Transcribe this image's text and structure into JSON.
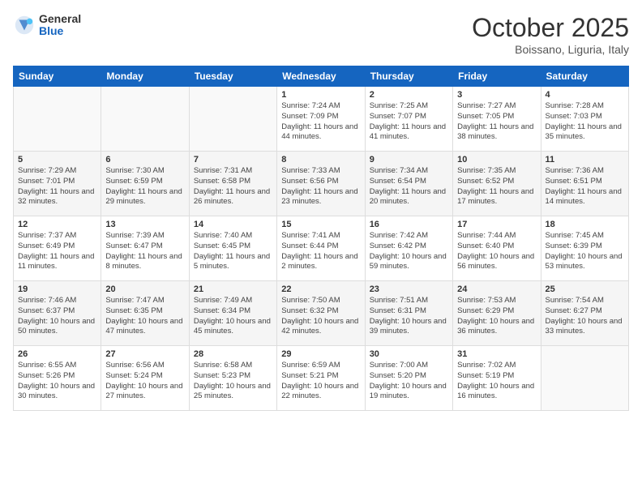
{
  "header": {
    "logo_general": "General",
    "logo_blue": "Blue",
    "month_title": "October 2025",
    "location": "Boissano, Liguria, Italy"
  },
  "weekdays": [
    "Sunday",
    "Monday",
    "Tuesday",
    "Wednesday",
    "Thursday",
    "Friday",
    "Saturday"
  ],
  "weeks": [
    [
      {
        "day": "",
        "info": ""
      },
      {
        "day": "",
        "info": ""
      },
      {
        "day": "",
        "info": ""
      },
      {
        "day": "1",
        "info": "Sunrise: 7:24 AM\nSunset: 7:09 PM\nDaylight: 11 hours\nand 44 minutes."
      },
      {
        "day": "2",
        "info": "Sunrise: 7:25 AM\nSunset: 7:07 PM\nDaylight: 11 hours\nand 41 minutes."
      },
      {
        "day": "3",
        "info": "Sunrise: 7:27 AM\nSunset: 7:05 PM\nDaylight: 11 hours\nand 38 minutes."
      },
      {
        "day": "4",
        "info": "Sunrise: 7:28 AM\nSunset: 7:03 PM\nDaylight: 11 hours\nand 35 minutes."
      }
    ],
    [
      {
        "day": "5",
        "info": "Sunrise: 7:29 AM\nSunset: 7:01 PM\nDaylight: 11 hours\nand 32 minutes."
      },
      {
        "day": "6",
        "info": "Sunrise: 7:30 AM\nSunset: 6:59 PM\nDaylight: 11 hours\nand 29 minutes."
      },
      {
        "day": "7",
        "info": "Sunrise: 7:31 AM\nSunset: 6:58 PM\nDaylight: 11 hours\nand 26 minutes."
      },
      {
        "day": "8",
        "info": "Sunrise: 7:33 AM\nSunset: 6:56 PM\nDaylight: 11 hours\nand 23 minutes."
      },
      {
        "day": "9",
        "info": "Sunrise: 7:34 AM\nSunset: 6:54 PM\nDaylight: 11 hours\nand 20 minutes."
      },
      {
        "day": "10",
        "info": "Sunrise: 7:35 AM\nSunset: 6:52 PM\nDaylight: 11 hours\nand 17 minutes."
      },
      {
        "day": "11",
        "info": "Sunrise: 7:36 AM\nSunset: 6:51 PM\nDaylight: 11 hours\nand 14 minutes."
      }
    ],
    [
      {
        "day": "12",
        "info": "Sunrise: 7:37 AM\nSunset: 6:49 PM\nDaylight: 11 hours\nand 11 minutes."
      },
      {
        "day": "13",
        "info": "Sunrise: 7:39 AM\nSunset: 6:47 PM\nDaylight: 11 hours\nand 8 minutes."
      },
      {
        "day": "14",
        "info": "Sunrise: 7:40 AM\nSunset: 6:45 PM\nDaylight: 11 hours\nand 5 minutes."
      },
      {
        "day": "15",
        "info": "Sunrise: 7:41 AM\nSunset: 6:44 PM\nDaylight: 11 hours\nand 2 minutes."
      },
      {
        "day": "16",
        "info": "Sunrise: 7:42 AM\nSunset: 6:42 PM\nDaylight: 10 hours\nand 59 minutes."
      },
      {
        "day": "17",
        "info": "Sunrise: 7:44 AM\nSunset: 6:40 PM\nDaylight: 10 hours\nand 56 minutes."
      },
      {
        "day": "18",
        "info": "Sunrise: 7:45 AM\nSunset: 6:39 PM\nDaylight: 10 hours\nand 53 minutes."
      }
    ],
    [
      {
        "day": "19",
        "info": "Sunrise: 7:46 AM\nSunset: 6:37 PM\nDaylight: 10 hours\nand 50 minutes."
      },
      {
        "day": "20",
        "info": "Sunrise: 7:47 AM\nSunset: 6:35 PM\nDaylight: 10 hours\nand 47 minutes."
      },
      {
        "day": "21",
        "info": "Sunrise: 7:49 AM\nSunset: 6:34 PM\nDaylight: 10 hours\nand 45 minutes."
      },
      {
        "day": "22",
        "info": "Sunrise: 7:50 AM\nSunset: 6:32 PM\nDaylight: 10 hours\nand 42 minutes."
      },
      {
        "day": "23",
        "info": "Sunrise: 7:51 AM\nSunset: 6:31 PM\nDaylight: 10 hours\nand 39 minutes."
      },
      {
        "day": "24",
        "info": "Sunrise: 7:53 AM\nSunset: 6:29 PM\nDaylight: 10 hours\nand 36 minutes."
      },
      {
        "day": "25",
        "info": "Sunrise: 7:54 AM\nSunset: 6:27 PM\nDaylight: 10 hours\nand 33 minutes."
      }
    ],
    [
      {
        "day": "26",
        "info": "Sunrise: 6:55 AM\nSunset: 5:26 PM\nDaylight: 10 hours\nand 30 minutes."
      },
      {
        "day": "27",
        "info": "Sunrise: 6:56 AM\nSunset: 5:24 PM\nDaylight: 10 hours\nand 27 minutes."
      },
      {
        "day": "28",
        "info": "Sunrise: 6:58 AM\nSunset: 5:23 PM\nDaylight: 10 hours\nand 25 minutes."
      },
      {
        "day": "29",
        "info": "Sunrise: 6:59 AM\nSunset: 5:21 PM\nDaylight: 10 hours\nand 22 minutes."
      },
      {
        "day": "30",
        "info": "Sunrise: 7:00 AM\nSunset: 5:20 PM\nDaylight: 10 hours\nand 19 minutes."
      },
      {
        "day": "31",
        "info": "Sunrise: 7:02 AM\nSunset: 5:19 PM\nDaylight: 10 hours\nand 16 minutes."
      },
      {
        "day": "",
        "info": ""
      }
    ]
  ]
}
